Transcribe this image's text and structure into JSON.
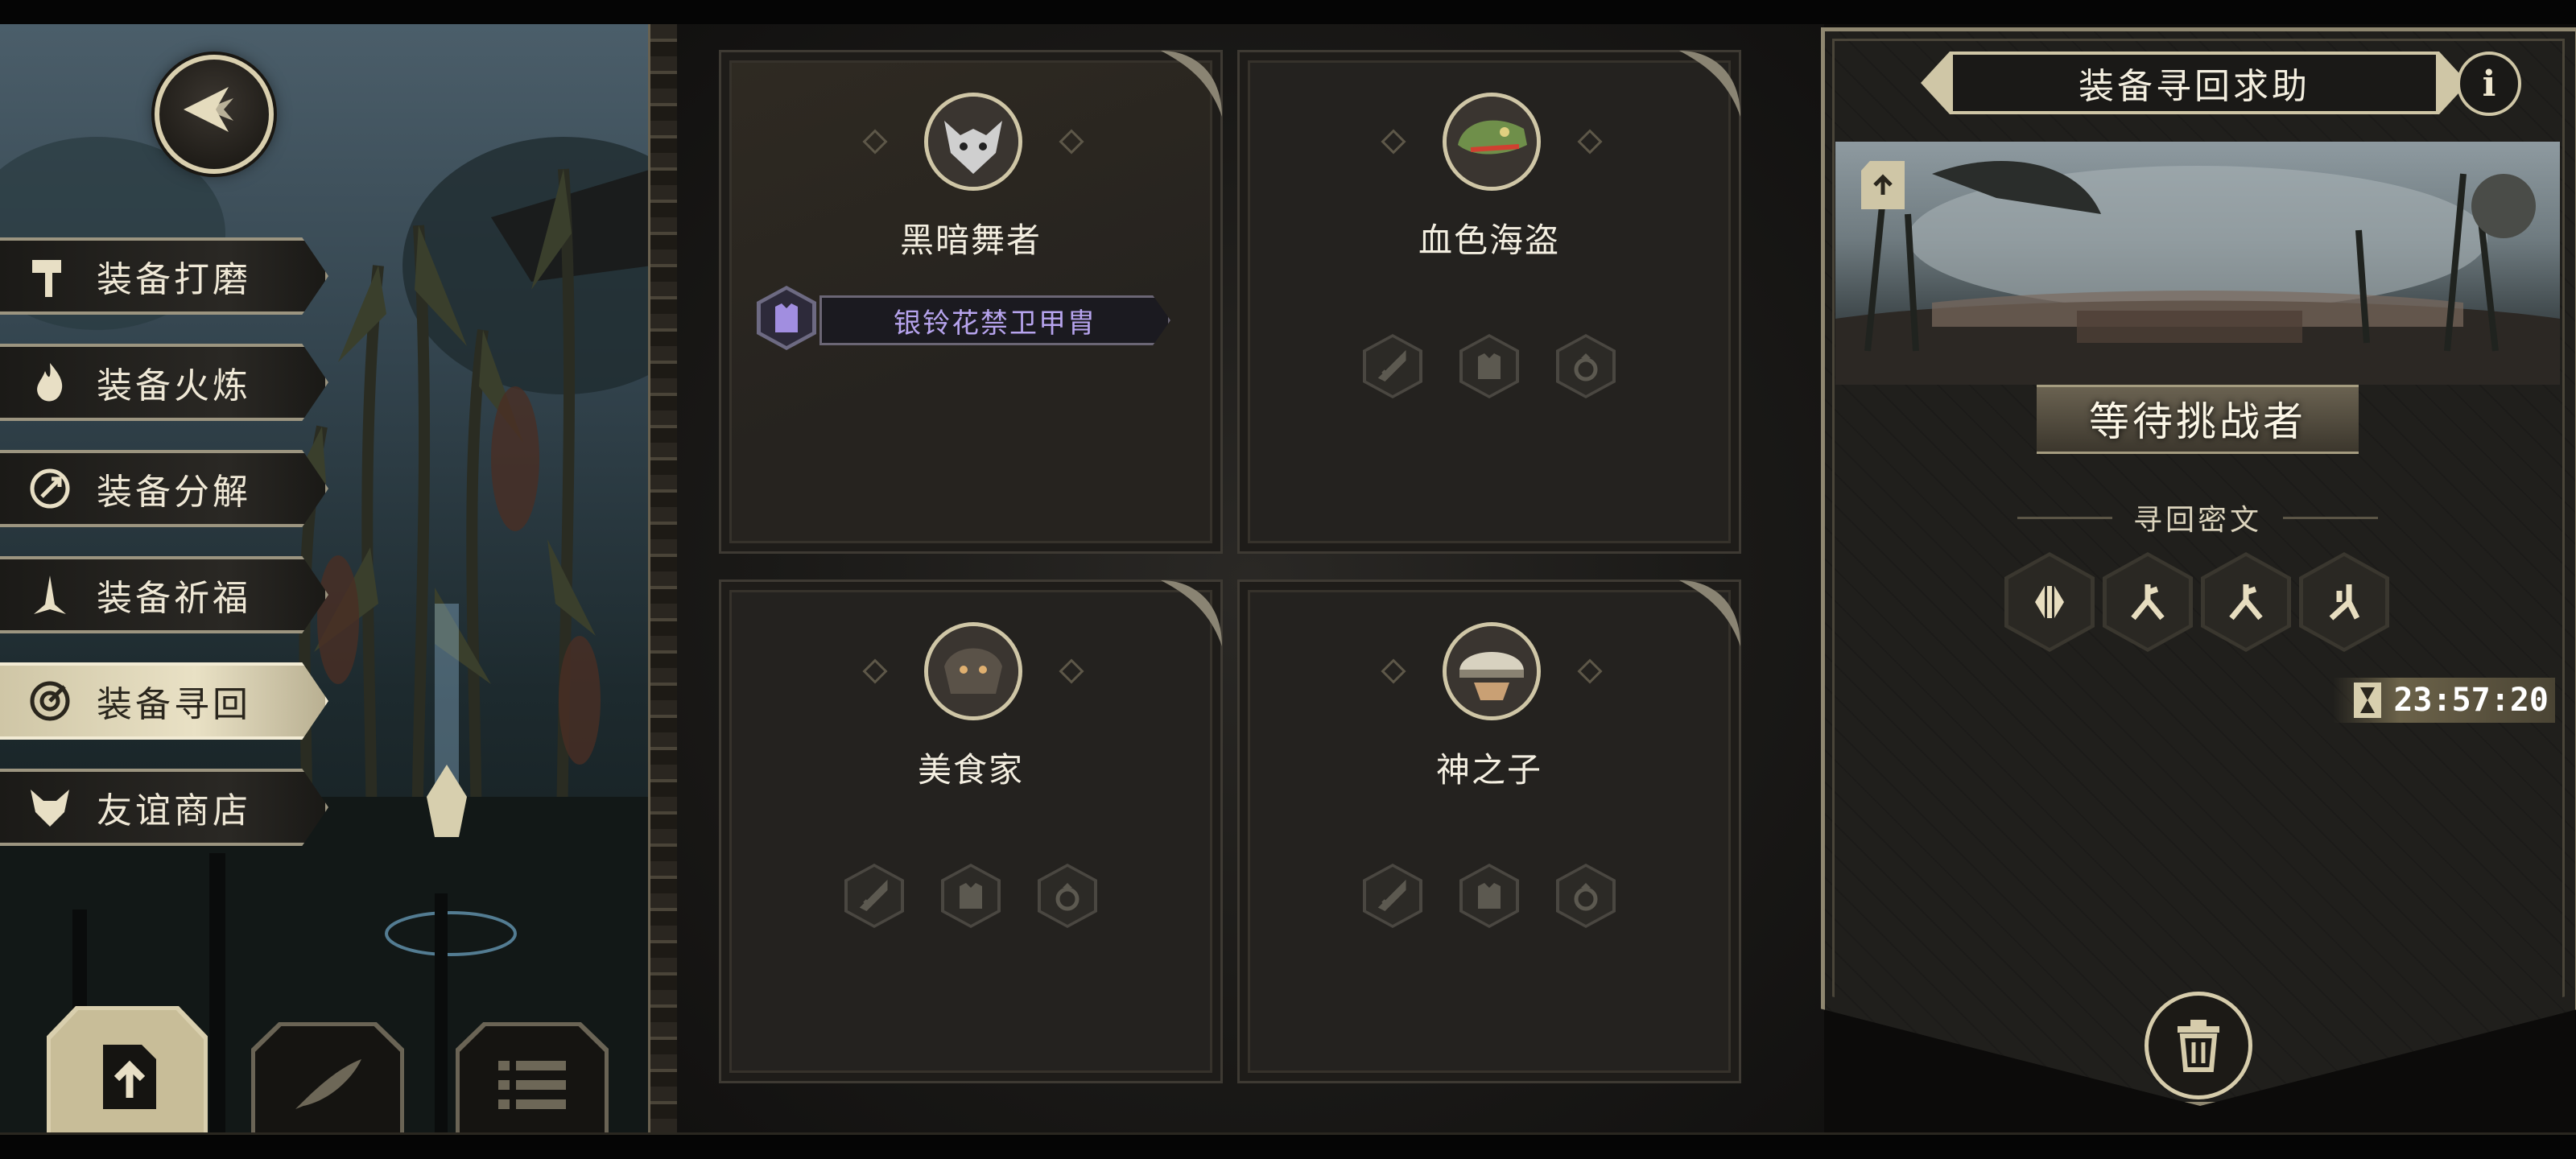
{
  "menu": {
    "items": [
      {
        "label": "装备打磨",
        "icon": "hammer-icon"
      },
      {
        "label": "装备火炼",
        "icon": "flame-icon"
      },
      {
        "label": "装备分解",
        "icon": "disassemble-icon"
      },
      {
        "label": "装备祈福",
        "icon": "pray-icon"
      },
      {
        "label": "装备寻回",
        "icon": "retrieve-icon",
        "active": true
      },
      {
        "label": "友谊商店",
        "icon": "fox-icon"
      }
    ]
  },
  "bottom_tabs": [
    {
      "icon": "upload-icon",
      "active": true
    },
    {
      "icon": "feather-icon",
      "active": false
    },
    {
      "icon": "list-icon",
      "active": false
    }
  ],
  "cards": [
    {
      "name": "黑暗舞者",
      "portrait": "rat-icon",
      "equipped_item": "银铃花禁卫甲胄"
    },
    {
      "name": "血色海盗",
      "portrait": "lizard-icon",
      "slots": [
        "sword-slot-icon",
        "armor-slot-icon",
        "ring-slot-icon"
      ]
    },
    {
      "name": "美食家",
      "portrait": "beast-icon",
      "slots": [
        "sword-slot-icon",
        "armor-slot-icon",
        "ring-slot-icon"
      ]
    },
    {
      "name": "神之子",
      "portrait": "helmet-icon",
      "slots": [
        "sword-slot-icon",
        "armor-slot-icon",
        "ring-slot-icon"
      ]
    }
  ],
  "panel": {
    "title": "装备寻回求助",
    "info_label": "i",
    "status": "等待挑战者",
    "rune_label": "寻回密文",
    "runes": [
      "rune-1-icon",
      "rune-2-icon",
      "rune-2-icon",
      "rune-3-icon"
    ],
    "timer": "23:57:20"
  },
  "colors": {
    "accent_gold": "#cfc6a6",
    "item_purple": "#b7a4ee",
    "panel_dark": "#1e1d1a"
  }
}
